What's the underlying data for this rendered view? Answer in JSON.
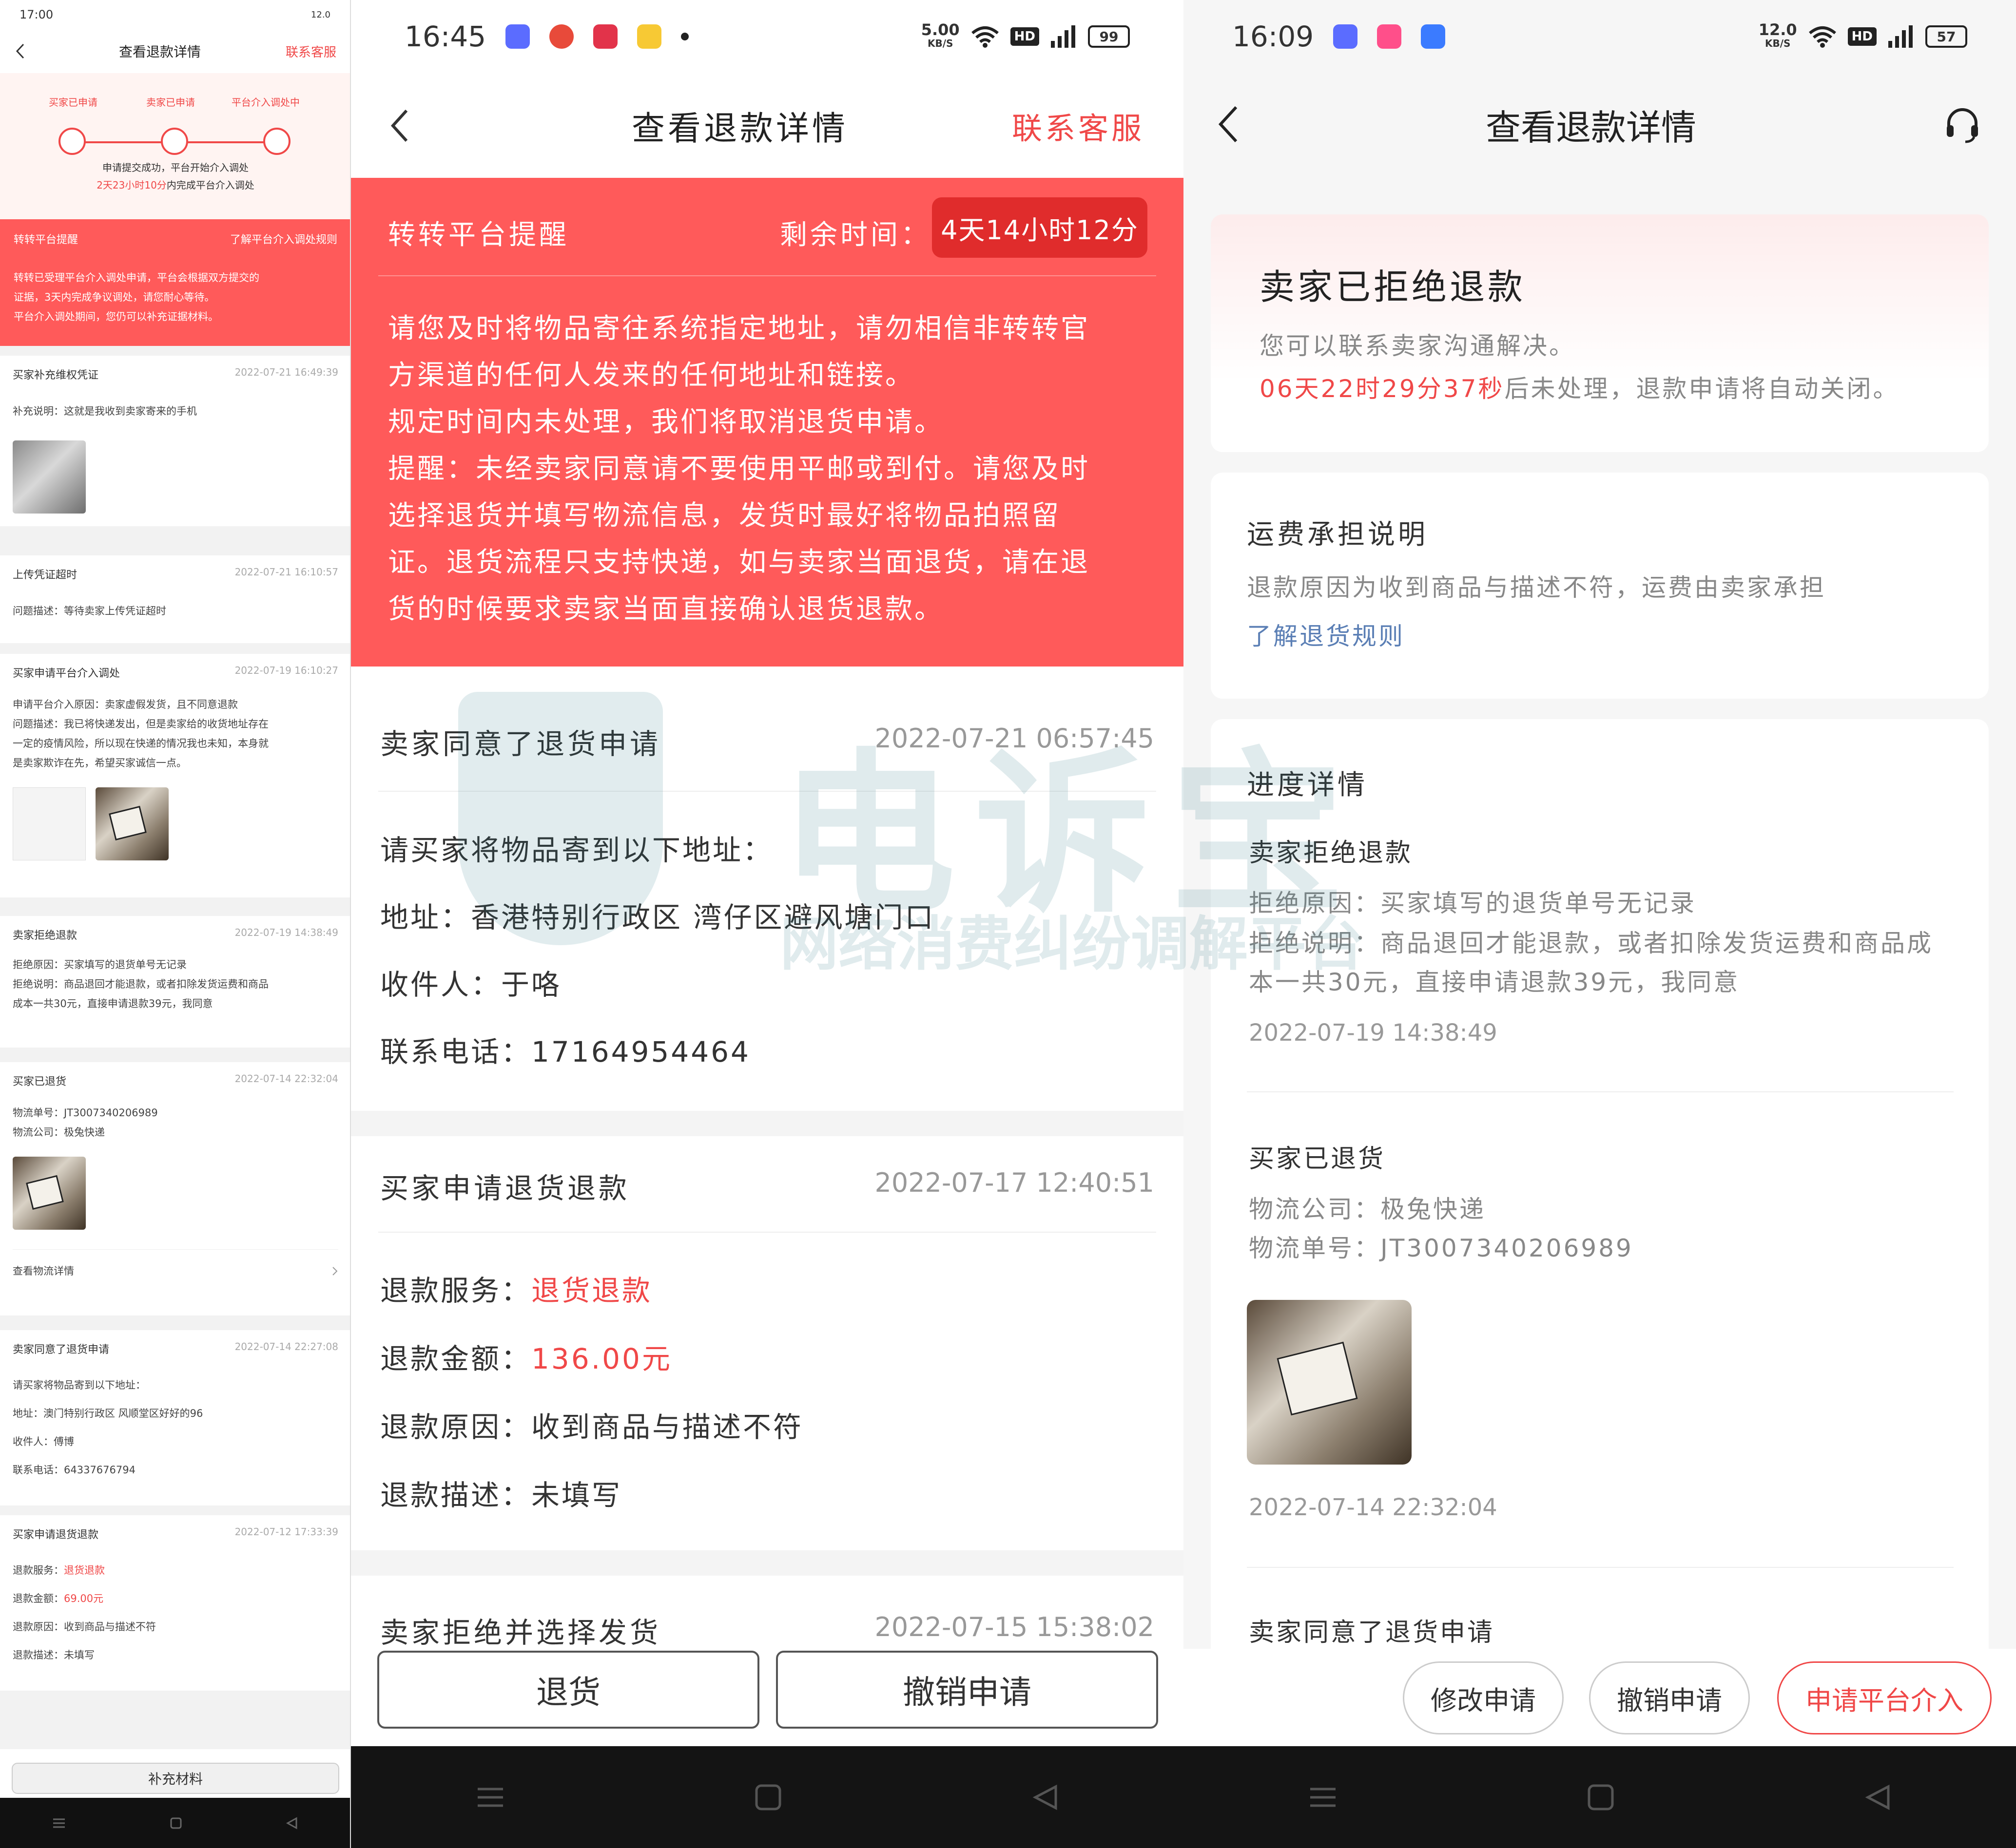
{
  "colors": {
    "accent": "#f04848",
    "banner": "#ff5a5a",
    "ink": "#333333"
  },
  "p1": {
    "status_time": "17:00",
    "status_net": "12.0",
    "title": "查看退款详情",
    "contact": "联系客服",
    "steps": [
      "买家已申请",
      "卖家已申请",
      "平台介入调处中"
    ],
    "step_note1": "申请提交成功，平台开始介入调处",
    "step_note2_red": "2天23小时10分",
    "step_note2": "内完成平台介入调处",
    "banner_title": "转转平台提醒",
    "banner_link": "了解平台介入调处规则",
    "banner_text": [
      "转转已受理平台介入调处申请，平台会根据双方提交的",
      "证据，3天内完成争议调处，请您耐心等待。",
      "平台介入调处期间，您仍可以补充证据材料。"
    ],
    "c1": {
      "title": "买家补充维权凭证",
      "time": "2022-07-21 16:49:39",
      "lines": [
        "补充说明：这就是我收到卖家寄来的手机"
      ]
    },
    "c2": {
      "title": "上传凭证超时",
      "time": "2022-07-21 16:10:57",
      "lines": [
        "问题描述：等待卖家上传凭证超时"
      ]
    },
    "c3": {
      "title": "买家申请平台介入调处",
      "time": "2022-07-19 16:10:27",
      "lines": [
        "申请平台介入原因：卖家虚假发货，且不同意退款",
        "问题描述：我已将快递发出，但是卖家给的收货地址存在",
        "一定的疫情风险，所以现在快递的情况我也未知，本身就",
        "是卖家欺诈在先，希望买家诚信一点。"
      ]
    },
    "c4": {
      "title": "卖家拒绝退款",
      "time": "2022-07-19 14:38:49",
      "lines": [
        "拒绝原因：买家填写的退货单号无记录",
        "拒绝说明：商品退回才能退款，或者扣除发货运费和商品",
        "成本一共30元，直接申请退款39元，我同意"
      ]
    },
    "c5": {
      "title": "买家已退货",
      "time": "2022-07-14 22:32:04",
      "lines": [
        "物流单号：JT3007340206989",
        "物流公司：极兔快递"
      ],
      "link": "查看物流详情"
    },
    "c6": {
      "title": "卖家同意了退货申请",
      "time": "2022-07-14 22:27:08",
      "lines": [
        "请买家将物品寄到以下地址：",
        "地址：澳门特别行政区 风顺堂区好好的96",
        "收件人：傅博",
        "联系电话：64337676794"
      ]
    },
    "c7": {
      "title": "买家申请退货退款",
      "time": "2022-07-12 17:33:39",
      "l1k": "退款服务：",
      "l1v": "退货退款",
      "l2k": "退款金额：",
      "l2v": "69.00元",
      "l3": "退款原因：收到商品与描述不符",
      "l4": "退款描述：未填写"
    },
    "bottom_btn": "补充材料"
  },
  "p2": {
    "status_time": "16:45",
    "status_speed": "5.00",
    "status_unit": "KB/S",
    "battery": "99",
    "title": "查看退款详情",
    "contact": "联系客服",
    "banner_title": "转转平台提醒",
    "remain_label": "剩余时间：",
    "remain_value": "4天14小时12分",
    "banner_lines": [
      "请您及时将物品寄往系统指定地址，请勿相信非转转官",
      "方渠道的任何人发来的任何地址和链接。",
      "规定时间内未处理，我们将取消退货申请。",
      "提醒：未经卖家同意请不要使用平邮或到付。请您及时",
      "选择退货并填写物流信息，发货时最好将物品拍照留",
      "证。退货流程只支持快递，如与卖家当面退货，请在退",
      "货的时候要求卖家当面直接确认退货退款。"
    ],
    "s1": {
      "title": "卖家同意了退货申请",
      "time": "2022-07-21 06:57:45",
      "lines": [
        "请买家将物品寄到以下地址：",
        "地址：香港特别行政区 湾仔区避风塘门口",
        "收件人：于咯",
        "联系电话：17164954464"
      ]
    },
    "s2": {
      "title": "买家申请退货退款",
      "time": "2022-07-17 12:40:51",
      "k1": "退款服务：",
      "v1": "退货退款",
      "k2": "退款金额：",
      "v2": "136.00元",
      "l3": "退款原因：收到商品与描述不符",
      "l4": "退款描述：未填写"
    },
    "s3": {
      "title": "卖家拒绝并选择发货",
      "time": "2022-07-15 15:38:02"
    },
    "btn_return": "退货",
    "btn_cancel": "撤销申请"
  },
  "p3": {
    "status_time": "16:09",
    "status_speed": "12.0",
    "status_unit": "KB/S",
    "battery": "57",
    "title": "查看退款详情",
    "top_title": "卖家已拒绝退款",
    "top_sub": "您可以联系卖家沟通解决。",
    "top_count_red": "06天22时29分37秒",
    "top_count": "后未处理，退款申请将自动关闭。",
    "fee_title": "运费承担说明",
    "fee_text": "退款原因为收到商品与描述不符，运费由卖家承担",
    "fee_link": "了解退货规则",
    "prog_title": "进度详情",
    "e1": {
      "title": "卖家拒绝退款",
      "l1": "拒绝原因：买家填写的退货单号无记录",
      "l2": "拒绝说明：商品退回才能退款，或者扣除发货运费和商品成",
      "l3": "本一共30元，直接申请退款39元，我同意",
      "time": "2022-07-19 14:38:49"
    },
    "e2": {
      "title": "买家已退货",
      "l1": "物流公司：极兔快递",
      "l2": "物流单号：JT3007340206989",
      "time": "2022-07-14 22:32:04"
    },
    "e3": {
      "title": "卖家同意了退货申请"
    },
    "btn_modify": "修改申请",
    "btn_cancel": "撤销申请",
    "btn_platform": "申请平台介入"
  },
  "watermark": {
    "big": "电诉宝",
    "small": "网络消费纠纷调解平台"
  }
}
